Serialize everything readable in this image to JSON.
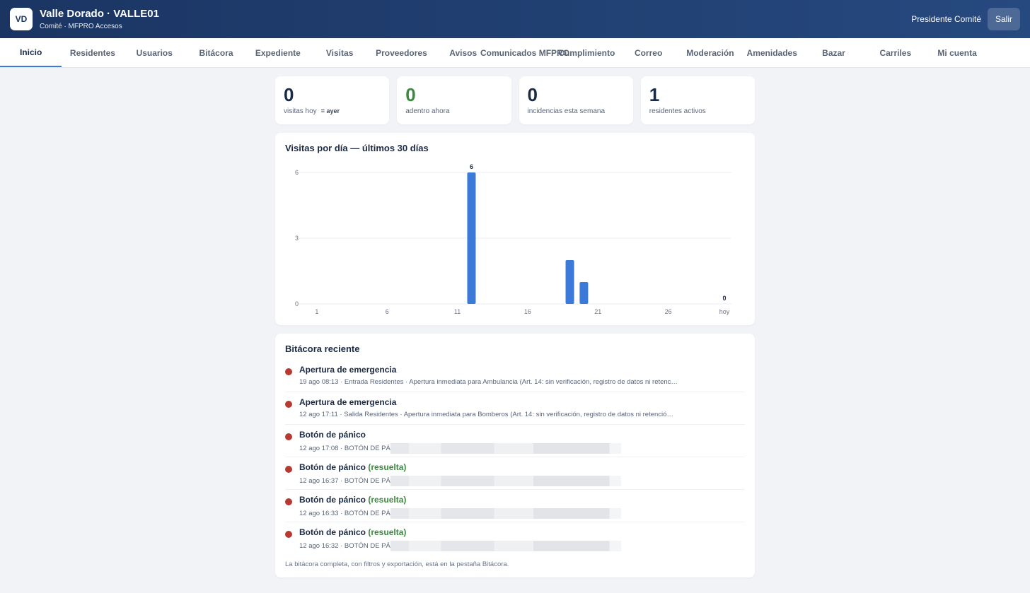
{
  "header": {
    "logo": "VD",
    "title": "Valle Dorado · VALLE01",
    "subtitle": "Comité · MFPRO Accesos",
    "user": "Presidente Comité",
    "logout": "Salir"
  },
  "tabs": [
    "Inicio",
    "Residentes",
    "Usuarios",
    "Bitácora",
    "Expediente",
    "Visitas",
    "Proveedores",
    "Avisos",
    "Comunicados MFPRO",
    "Cumplimiento",
    "Correo",
    "Moderación",
    "Amenidades",
    "Bazar",
    "Carriles",
    "Mi cuenta"
  ],
  "active_tab": "Inicio",
  "stats": [
    {
      "value": "0",
      "label": "visitas hoy",
      "extra": "= ayer"
    },
    {
      "value": "0",
      "label": "adentro ahora"
    },
    {
      "value": "0",
      "label": "incidencias esta semana"
    },
    {
      "value": "1",
      "label": "residentes activos"
    }
  ],
  "chart": {
    "title": "Visitas por día — últimos 30 días"
  },
  "chart_data": {
    "type": "bar",
    "title": "Visitas por día — últimos 30 días",
    "x": [
      1,
      2,
      3,
      4,
      5,
      6,
      7,
      8,
      9,
      10,
      11,
      12,
      13,
      14,
      15,
      16,
      17,
      18,
      19,
      20,
      21,
      22,
      23,
      24,
      25,
      26,
      27,
      28,
      29,
      30
    ],
    "values": [
      0,
      0,
      0,
      0,
      0,
      0,
      0,
      0,
      0,
      0,
      0,
      6,
      0,
      0,
      0,
      0,
      0,
      0,
      2,
      1,
      0,
      0,
      0,
      0,
      0,
      0,
      0,
      0,
      0,
      0
    ],
    "x_tick_labels": [
      "1",
      "6",
      "11",
      "16",
      "21",
      "26",
      "hoy"
    ],
    "y_ticks": [
      0,
      3,
      6
    ],
    "ylim": [
      0,
      6
    ],
    "data_labels": [
      {
        "index": 11,
        "text": "6"
      },
      {
        "index": 29,
        "text": "0"
      }
    ],
    "bar_color": "#3b7ad9"
  },
  "log": {
    "title": "Bitácora reciente",
    "items": [
      {
        "title": "Apertura de emergencia",
        "status": "",
        "detail": "19 ago 08:13 · Entrada Residentes · Apertura inmediata para Ambulancia (Art. 14: sin verificación, registro de datos ni retenc…",
        "redacted": false
      },
      {
        "title": "Apertura de emergencia",
        "status": "",
        "detail": "12 ago 17:11 · Salida Residentes · Apertura inmediata para Bomberos (Art. 14: sin verificación, registro de datos ni retenció…",
        "redacted": false
      },
      {
        "title": "Botón de pánico",
        "status": "",
        "detail": "12 ago 17:08 · BOTÓN DE PÁ",
        "redacted": true
      },
      {
        "title": "Botón de pánico",
        "status": "(resuelta)",
        "detail": "12 ago 16:37 · BOTÓN DE PÁ",
        "redacted": true
      },
      {
        "title": "Botón de pánico",
        "status": "(resuelta)",
        "detail": "12 ago 16:33 · BOTÓN DE PÁ",
        "redacted": true
      },
      {
        "title": "Botón de pánico",
        "status": "(resuelta)",
        "detail": "12 ago 16:32 · BOTÓN DE PÁ",
        "redacted": true
      }
    ],
    "footnote": "La bitácora completa, con filtros y exportación, está en la pestaña Bitácora."
  }
}
